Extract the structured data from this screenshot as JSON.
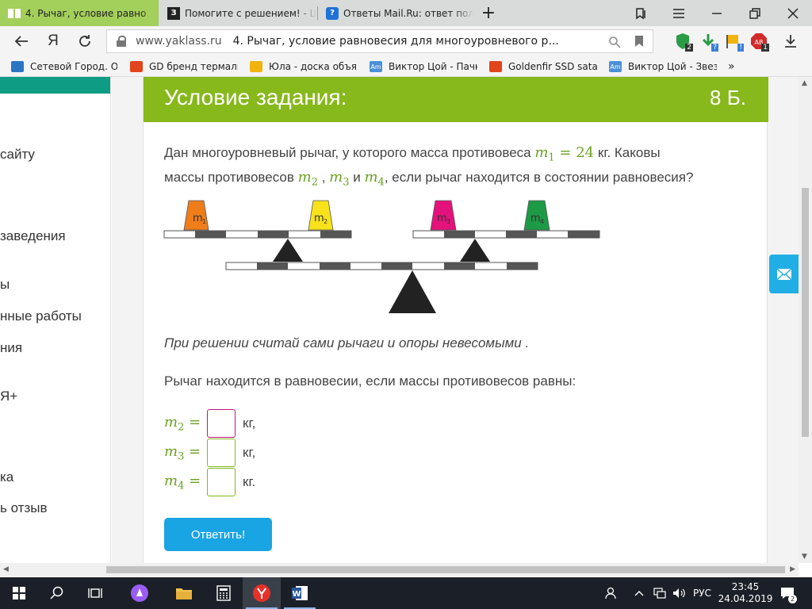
{
  "browser": {
    "tabs": [
      {
        "title": "4. Рычаг, условие равно",
        "icon": "yaklass-icon",
        "active": true
      },
      {
        "title": "Помогите с решением! - Ш",
        "icon": "znanija-icon",
        "active": false
      },
      {
        "title": "Ответы Mail.Ru: ответ поль",
        "icon": "mail-answers-icon",
        "active": false
      }
    ],
    "new_tab": "+",
    "address": {
      "domain": "www.yaklass.ru",
      "title": "4. Рычаг, условие равновесия для многоуровневого р..."
    },
    "extensions": [
      {
        "icon": "shield-icon",
        "badge": "2",
        "color": "#2c9b46"
      },
      {
        "icon": "download-arrow-icon",
        "badge": "?",
        "color": "#3c7fd8"
      },
      {
        "icon": "flag-icon",
        "badge": "!",
        "color": "#3c7fd8"
      },
      {
        "icon": "adblock-icon",
        "badge": "1",
        "color": "#d32a2a"
      }
    ],
    "bookmarks": [
      {
        "label": "Сетевой Город. Об",
        "color": "#2b75c3"
      },
      {
        "label": "GD бренд термаль",
        "color": "#e2441c"
      },
      {
        "label": "Юла - доска объяв",
        "color": "#f2b310"
      },
      {
        "label": "Виктор Цой - Пачк",
        "color": "#4a90d9"
      },
      {
        "label": "Goldenfir SSD sata",
        "color": "#e2441c"
      },
      {
        "label": "Виктор Цой - Звез",
        "color": "#4a90d9"
      }
    ],
    "bookmarks_more": "»"
  },
  "sidebar": {
    "items": [
      "сайту",
      "заведения",
      "ы",
      "нные работы",
      "ния",
      "Я+",
      "ка",
      "ь отзыв"
    ]
  },
  "task": {
    "header_title": "Условие задания:",
    "points": "8 Б.",
    "intro_a": "Дан многоуровневый рычаг, у которого масса противовеса",
    "m1_value": "24",
    "unit_kg": "кг",
    "intro_b": ". Каковы",
    "intro_c": "массы противовесов",
    "and_word": "и",
    "intro_d": ", если рычаг находится в состоянии равновесия?",
    "note": "При решении считай сами рычаги и опоры невесомыми .",
    "question": "Рычаг находится в равновесии, если массы противовесов равны:",
    "weights": [
      {
        "label": "m",
        "sub": "1",
        "color": "#ef7d1a"
      },
      {
        "label": "m",
        "sub": "2",
        "color": "#f7e21b"
      },
      {
        "label": "m",
        "sub": "3",
        "color": "#e4127c"
      },
      {
        "label": "m",
        "sub": "4",
        "color": "#1d9a45"
      }
    ],
    "answers": [
      {
        "var": "m",
        "sub": "2",
        "unit": "кг,"
      },
      {
        "var": "m",
        "sub": "3",
        "unit": "кг,"
      },
      {
        "var": "m",
        "sub": "4",
        "unit": "кг."
      }
    ],
    "submit_label": "Ответить!"
  },
  "taskbar": {
    "lang": "РУС",
    "time": "23:45",
    "date": "24.04.2019",
    "notifications": "2"
  }
}
